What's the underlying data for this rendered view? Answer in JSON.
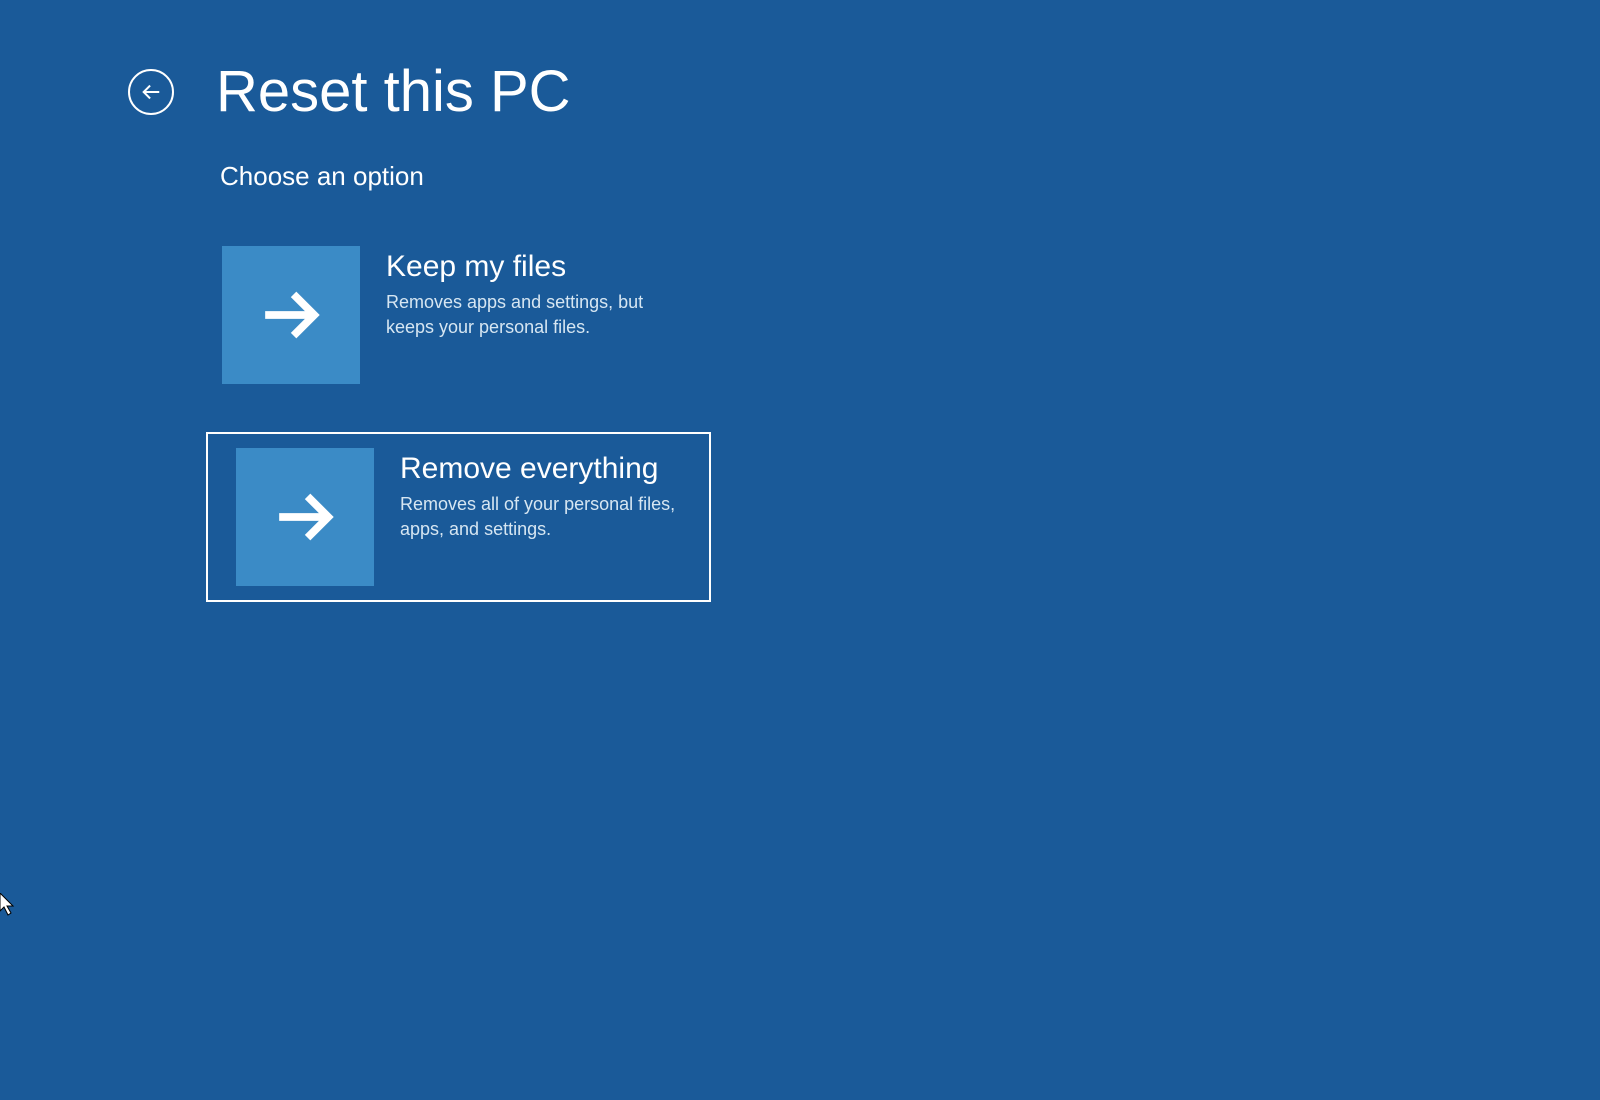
{
  "header": {
    "title": "Reset this PC"
  },
  "subtitle": "Choose an option",
  "options": [
    {
      "title": "Keep my files",
      "description": "Removes apps and settings, but keeps your personal files.",
      "selected": false
    },
    {
      "title": "Remove everything",
      "description": "Removes all of your personal files, apps, and settings.",
      "selected": true
    }
  ]
}
